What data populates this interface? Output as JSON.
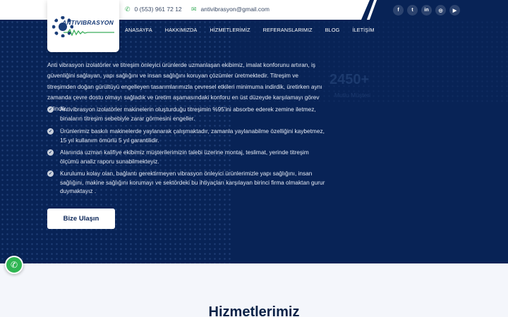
{
  "topbar": {
    "phone": "0 (553) 961 72 12",
    "email": "antivibrasyon@gmail.com",
    "phone_icon": "phone-icon",
    "email_icon": "envelope-icon",
    "social": [
      {
        "icon": "facebook-icon",
        "glyph": "f"
      },
      {
        "icon": "twitter-icon",
        "glyph": "t"
      },
      {
        "icon": "linkedin-icon",
        "glyph": "in"
      },
      {
        "icon": "instagram-icon",
        "glyph": "◎"
      },
      {
        "icon": "youtube-icon",
        "glyph": "▶"
      }
    ]
  },
  "logo": {
    "text": "ANTIVIBRASYON"
  },
  "nav": [
    "ANASAYFA",
    "HAKKIMIZDA",
    "HİZMETLERİMİZ",
    "REFERANSLARIMIZ",
    "BLOG",
    "İLETİŞİM"
  ],
  "intro": "Anti vibrasyon izolatörler ve titreşim önleyici ürünlerde uzmanlaşan ekibimiz, imalat konforunu artıran, iş güvenliğini sağlayan, yapı sağlığını ve insan sağlığını koruyan çözümler üretmektedir. Titreşim ve titreşimden doğan gürültüyü engelleyen tasarımlarımızla çevresel etkileri minimuma indirdik, üretirken aynı zamanda çevre dostu olmayı sağladık ve üretim aşamasındaki konforu en üst düzeyde karşılamayı görev edindik.",
  "features": [
    "Antivibrasyon izolatörler makinelerin oluşturduğu titreşimin %95'ini absorbe ederek zemine iletmez, binaların titreşim sebebiyle zarar görmesini engeller.",
    "Ürünlerimiz baskılı makinelerde yaylanarak çalışmaktadır, zamanla yaylanabilme özelliğini kaybetmez, 15 yıl kullanım ömürlü 5 yıl garantilidir.",
    "Alanında uzman kalifiye ekibimiz müşterilerimizin talebi üzerine montaj, teslimat, yerinde titreşim ölçümü analiz raporu sunabilmekteyiz.",
    "Kurulumu kolay olan, bağlantı gerektirmeyen vibrasyon önleyici ürünlerimizle yapı sağlığını, insan sağlığını, makine sağlığını korumayı ve sektördeki bu ihtiyaçları karşılayan birinci firma olmaktan gurur duymaktayız ."
  ],
  "stat": {
    "number": "2450+",
    "label": "Mutlu Müşteri"
  },
  "cta": "Bize Ulaşın",
  "section_title": "Hizmetlerimiz",
  "colors": {
    "navy": "#082356",
    "green": "#3cae5c",
    "whatsapp": "#2fb552"
  }
}
